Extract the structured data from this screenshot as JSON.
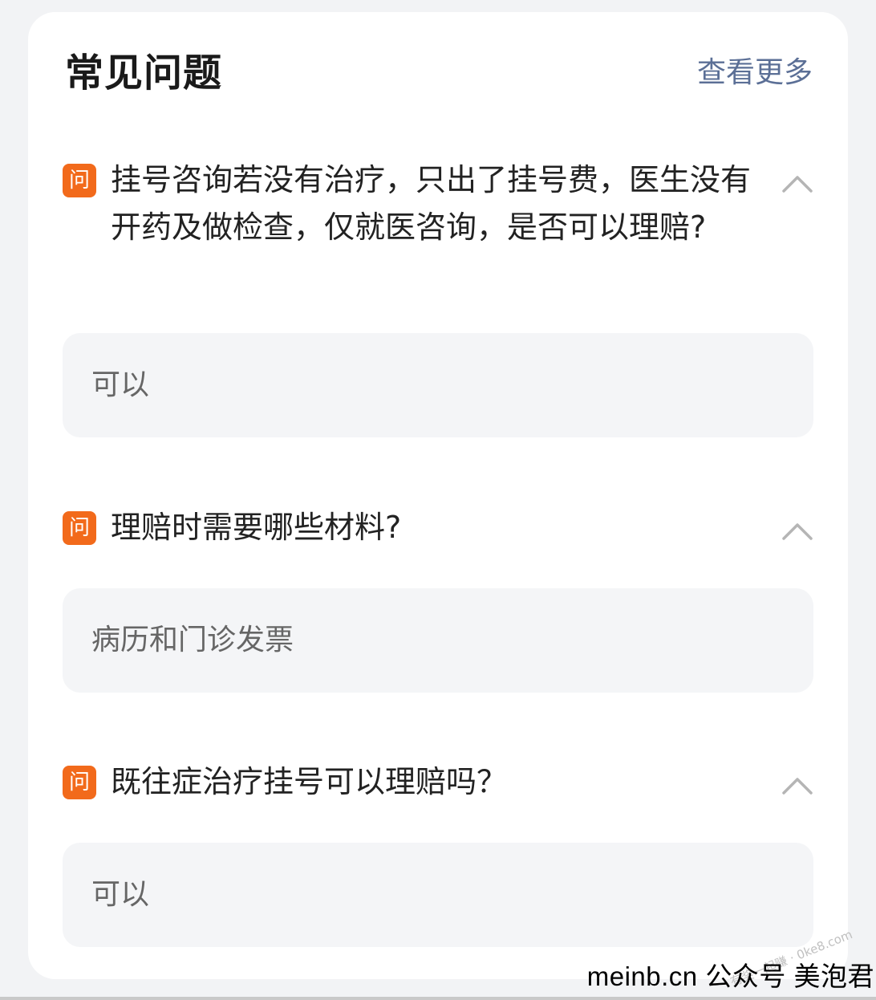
{
  "header": {
    "title": "常见问题",
    "view_more": "查看更多"
  },
  "faq": [
    {
      "badge": "问",
      "question": "挂号咨询若没有治疗，只出了挂号费，医生没有开药及做检查，仅就医咨询，是否可以理赔?",
      "answer": "可以",
      "icon": "chevron-up-icon"
    },
    {
      "badge": "问",
      "question": "理赔时需要哪些材料?",
      "answer": "病历和门诊发票",
      "icon": "chevron-up-icon"
    },
    {
      "badge": "问",
      "question": "既往症治疗挂号可以理赔吗？",
      "answer": "可以",
      "icon": "chevron-up-icon"
    }
  ],
  "watermark": {
    "text": "meinb.cn  公众号 美泡君",
    "faint": "有奖一起赚 · 0ke8.com"
  },
  "colors": {
    "badge": "#f26a1b",
    "link": "#5b6f96",
    "answer_bg": "#f4f5f7",
    "page_bg": "#f2f3f5"
  }
}
